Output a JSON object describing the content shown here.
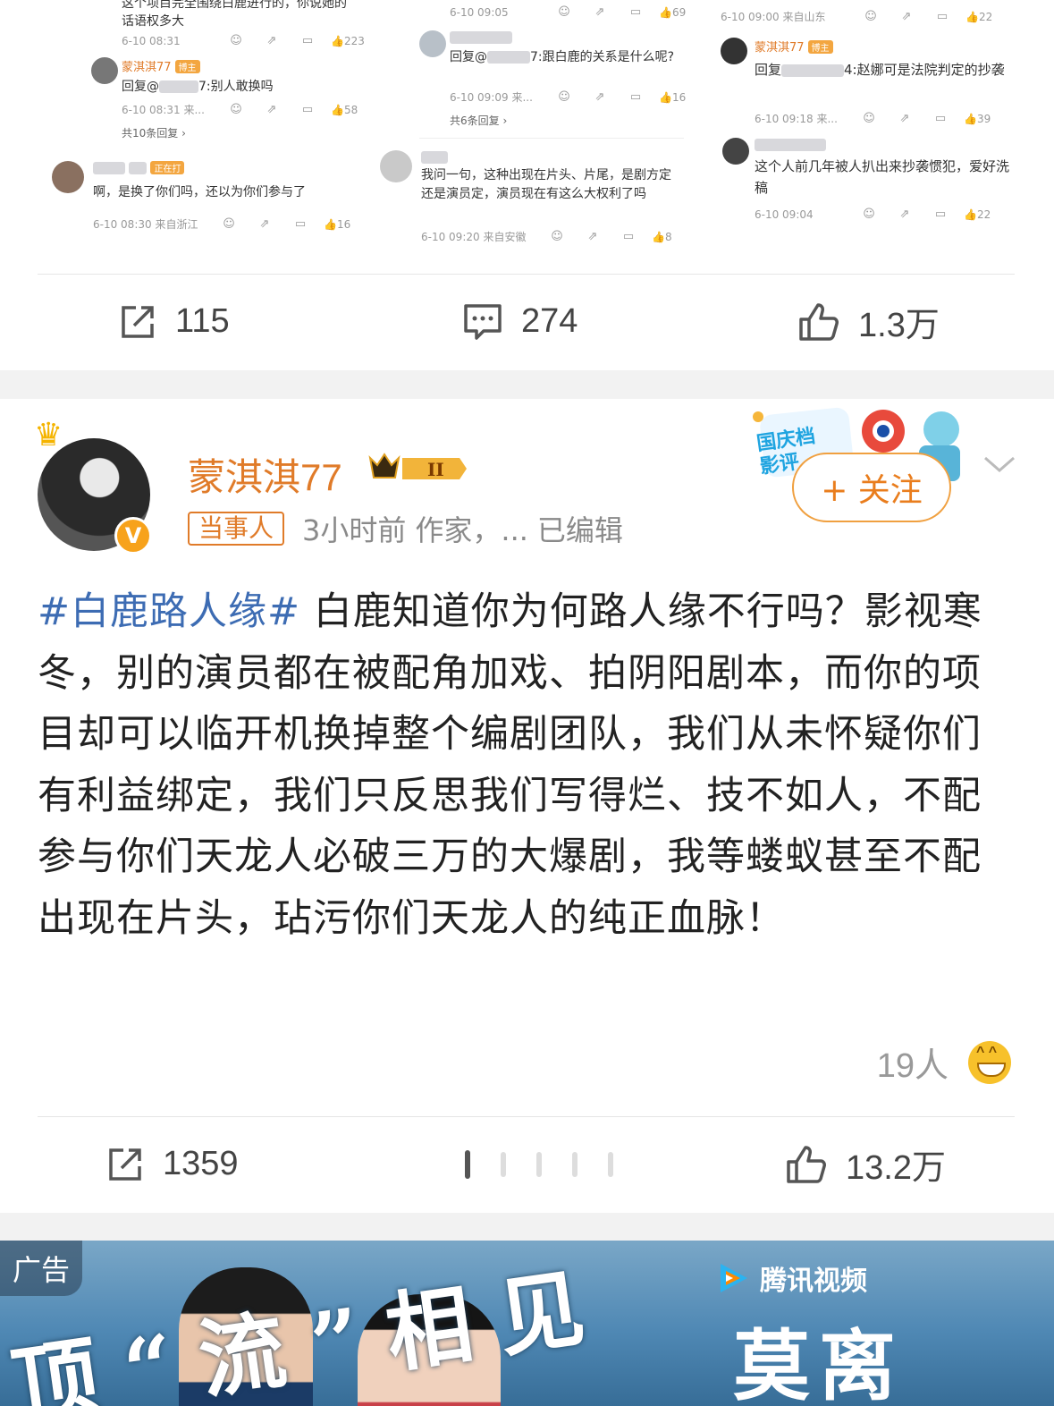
{
  "top_screenshot": {
    "col1": {
      "c0_text": "这个项目完全围绕白鹿进行的，你说她的话语权多大",
      "c0_time": "6-10 08:31",
      "c0_likes": "223",
      "c1_nick": "蒙淇淇77",
      "c1_badge": "博主",
      "c1_text_prefix": "回复@",
      "c1_text_suffix": "7:别人敢换吗",
      "c1_time": "6-10 08:31 来...",
      "c1_likes": "58",
      "c1_more": "共10条回复 ›",
      "c2_badge": "正在打",
      "c2_text": "啊，是换了你们吗，还以为你们参与了",
      "c2_time": "6-10 08:30 来自浙江",
      "c2_likes": "16"
    },
    "col2": {
      "c0_time": "6-10 09:05",
      "c0_likes": "69",
      "c1_text_prefix": "回复@",
      "c1_text_suffix": "7:跟白鹿的关系是什么呢?",
      "c1_time": "6-10 09:09 来...",
      "c1_likes": "16",
      "c1_more": "共6条回复 ›",
      "c2_text": "我问一句，这种出现在片头、片尾，是剧方定还是演员定，演员现在有这么大权利了吗",
      "c2_time": "6-10 09:20 来自安徽",
      "c2_likes": "8"
    },
    "col3": {
      "c0_time": "6-10 09:00 来自山东",
      "c0_likes": "22",
      "c1_nick": "蒙淇淇77",
      "c1_badge": "博主",
      "c1_text_prefix": "回复",
      "c1_text_suffix": "4:赵娜可是法院判定的抄袭",
      "c1_time": "6-10 09:18 来...",
      "c1_likes": "39",
      "c2_text": "这个人前几年被人扒出来抄袭惯犯，爱好洗稿",
      "c2_time": "6-10 09:04",
      "c2_likes": "22"
    }
  },
  "bar1": {
    "reposts": "115",
    "comments": "274",
    "likes": "1.3万"
  },
  "post": {
    "username": "蒙淇淇77",
    "level_icon": "crown-level-badge",
    "tag": "当事人",
    "time": "3小时前",
    "source": "作家，...",
    "edited": "已编辑",
    "festival_label": "国庆档 影评",
    "follow_label": "+ 关注",
    "hashtag": "#白鹿路人缘#",
    "body": " 白鹿知道你为何路人缘不行吗？影视寒冬，别的演员都在被配角加戏、拍阴阳剧本，而你的项目却可以临开机换掉整个编剧团队，我们从未怀疑你们有利益绑定，我们只反思我们写得烂、技不如人，不配参与你们天龙人必破三万的大爆剧，我等蝼蚁甚至不配出现在片头，玷污你们天龙人的纯正血脉！",
    "reaction_count": "19人"
  },
  "bar2": {
    "reposts": "1359",
    "likes": "13.2万"
  },
  "ad": {
    "label": "广告",
    "title": "顶“流”相见",
    "brand": "腾讯视频",
    "drama": "莫离"
  },
  "colors": {
    "accent_orange": "#e07b29",
    "hashtag_blue": "#3d6cb3",
    "divider": "#e6e6e6"
  }
}
